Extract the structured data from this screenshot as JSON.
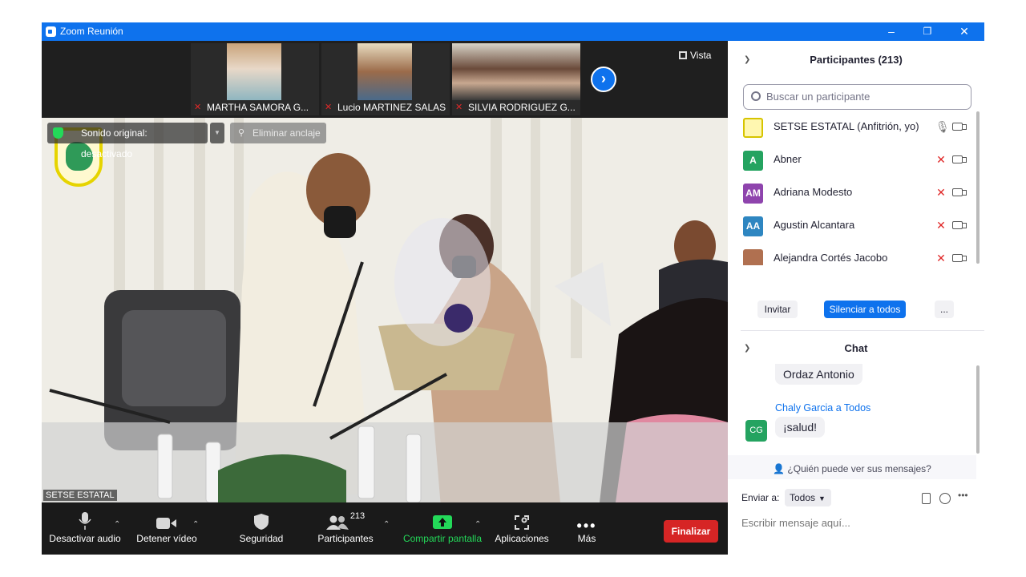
{
  "window": {
    "title": "Zoom Reunión",
    "minimize": "–",
    "restore": "❐",
    "close": "✕"
  },
  "thumbnails": [
    {
      "name": "MARTHA SAMORA G...",
      "muted": true
    },
    {
      "name": "Lucio MARTINEZ SALAS",
      "muted": true
    },
    {
      "name": "SILVIA RODRIGUEZ G...",
      "muted": true
    }
  ],
  "next_arrow": "›",
  "view_label": "Vista",
  "main_video": {
    "sound_status": "Sonido original: desactivado",
    "unpin_label": "Eliminar anclaje",
    "speaker_label": "SETSE ESTATAL"
  },
  "toolbar": {
    "mute": "Desactivar audio",
    "video": "Detener vídeo",
    "security": "Seguridad",
    "participants": "Participantes",
    "participants_count": "213",
    "share": "Compartir pantalla",
    "apps": "Aplicaciones",
    "more": "Más",
    "end": "Finalizar"
  },
  "participants_panel": {
    "title": "Participantes (213)",
    "search_placeholder": "Buscar un participante",
    "list": [
      {
        "initials": "",
        "name": "SETSE ESTATAL (Anfitrión, yo)",
        "color": "#f0e68c",
        "mic_on": true
      },
      {
        "initials": "A",
        "name": "Abner",
        "color": "#24a360",
        "mic_on": false
      },
      {
        "initials": "AM",
        "name": "Adriana Modesto",
        "color": "#8e44ad",
        "mic_on": false
      },
      {
        "initials": "AA",
        "name": "Agustin Alcantara",
        "color": "#2e86c1",
        "mic_on": false
      },
      {
        "initials": "",
        "name": "Alejandra Cortés Jacobo",
        "color": "#b07050",
        "mic_on": false
      }
    ],
    "invite": "Invitar",
    "mute_all": "Silenciar a todos",
    "more": "..."
  },
  "chat_panel": {
    "title": "Chat",
    "prev_message": "Ordaz Antonio",
    "sender": "Chaly Garcia",
    "to_text": " a Todos",
    "avatar_initials": "CG",
    "message": "¡salud!",
    "who_sees": "¿Quién puede ver sus mensajes?",
    "send_to_label": "Enviar a:",
    "send_to_value": "Todos",
    "input_placeholder": "Escribir mensaje aquí..."
  },
  "colors": {
    "accent": "#0e72ed",
    "end_button": "#d62525",
    "share_green": "#23d959"
  }
}
